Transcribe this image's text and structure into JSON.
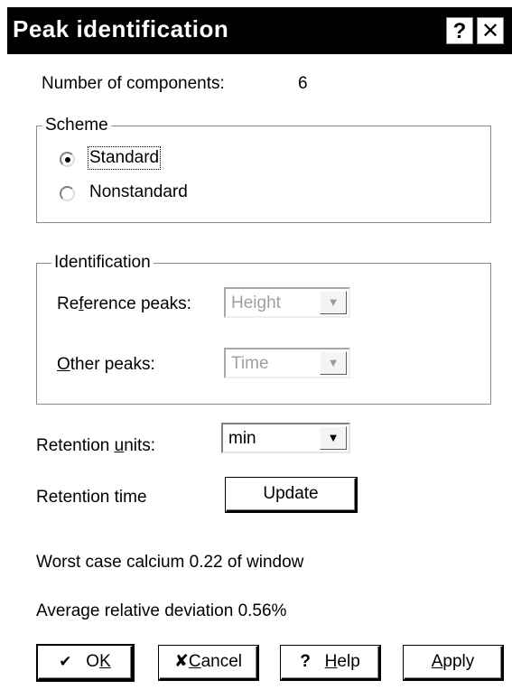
{
  "window": {
    "title": "Peak identification",
    "help_glyph": "?",
    "close_glyph": "✕"
  },
  "components": {
    "label": "Number of components:",
    "value": "6"
  },
  "scheme": {
    "legend": "Scheme",
    "options": [
      {
        "label": "Standard",
        "selected": true
      },
      {
        "label": "Nonstandard",
        "selected": false
      }
    ]
  },
  "identification": {
    "legend": "Identification",
    "reference_label": "Reference peaks:",
    "reference_value": "Height",
    "other_label": "Other peaks:",
    "other_value": "Time"
  },
  "retention_units": {
    "label": "Retention units:",
    "value": "min"
  },
  "retention_time": {
    "label": "Retention time",
    "button": "Update"
  },
  "stats": {
    "worst_case": "Worst case calcium 0.22 of window",
    "avg_deviation": "Average relative deviation 0.56%"
  },
  "buttons": {
    "ok": "OK",
    "cancel": "Cancel",
    "help": "Help",
    "apply": "Apply"
  },
  "icons": {
    "check": "checkmark-icon",
    "x": "x-icon",
    "question": "question-icon",
    "arrow": "dropdown-arrow-icon"
  },
  "colors": {
    "titlebar_bg": "#000000",
    "titlebar_text": "#ffffff",
    "disabled_text": "#a0a0a0"
  }
}
